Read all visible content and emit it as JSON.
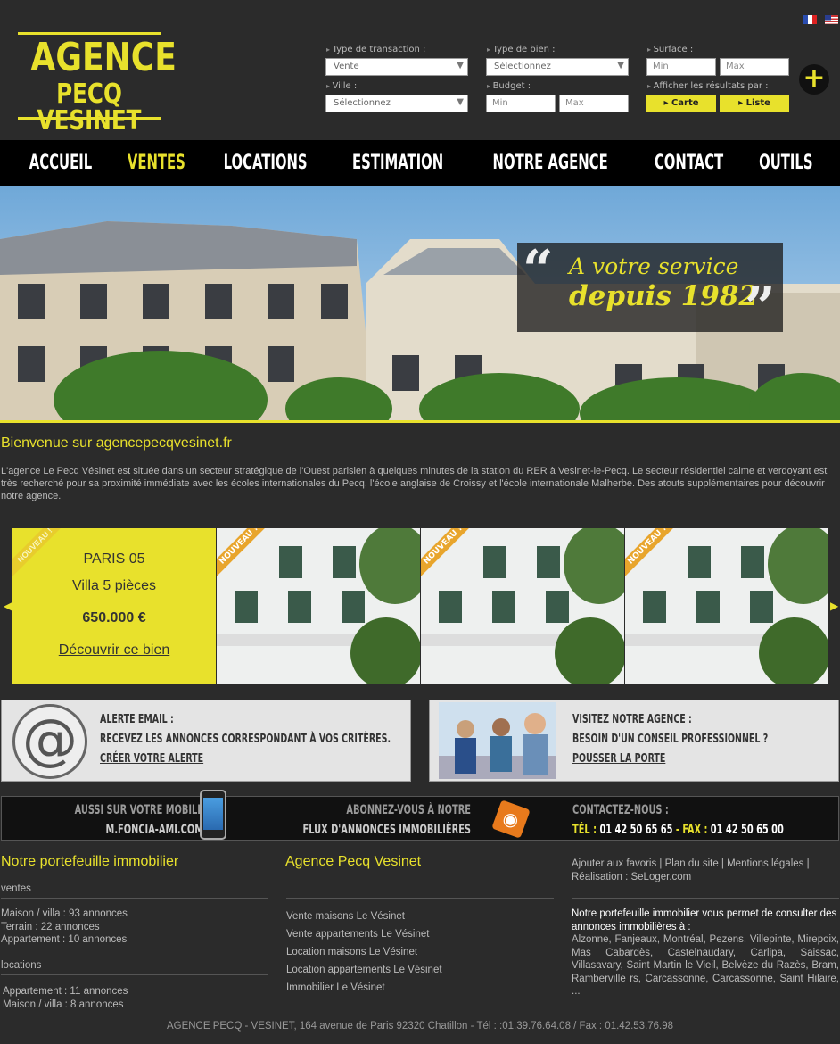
{
  "logo": {
    "line1": "AGENCE",
    "line2": "PECQ VESINET"
  },
  "search": {
    "transaction": {
      "label": "Type de transaction :",
      "value": "Vente"
    },
    "type_bien": {
      "label": "Type de bien :",
      "value": "Sélectionnez"
    },
    "surface": {
      "label": "Surface :",
      "min": "Min",
      "max": "Max"
    },
    "ville": {
      "label": "Ville :",
      "value": "Sélectionnez"
    },
    "budget": {
      "label": "Budget :",
      "min": "Min",
      "max": "Max"
    },
    "afficher": {
      "label": "Afficher les résultats par :",
      "carte": "Carte",
      "liste": "Liste"
    },
    "plus": "+"
  },
  "nav": [
    "ACCUEIL",
    "VENTES",
    "LOCATIONS",
    "ESTIMATION",
    "NOTRE AGENCE",
    "CONTACT",
    "OUTILS"
  ],
  "hero": {
    "quote_line1": "A votre service",
    "quote_line2": "depuis 1982"
  },
  "welcome": "Bienvenue sur agencepecqvesinet.fr",
  "intro": "L'agence Le Pecq Vésinet est située dans un secteur stratégique de l'Ouest parisien à quelques minutes de la station du RER à Vesinet-le-Pecq. Le secteur résidentiel calme et verdoyant est très recherché pour sa proximité immédiate avec les écoles internationales du Pecq, l'école anglaise de Croissy et l'école internationale Malherbe. Des atouts supplémentaires pour découvrir notre agence.",
  "carousel": {
    "ribbon": "NOUVEAU !",
    "feature": {
      "city": "PARIS 05",
      "type": "Villa 5 pièces",
      "price": "650.000 €",
      "link": "Découvrir ce bien"
    }
  },
  "promo_email": {
    "line1": "ALERTE EMAIL :",
    "line2": "RECEVEZ LES ANNONCES CORRESPONDANT À VOS CRITÈRES.",
    "link": "CRÉER VOTRE ALERTE"
  },
  "promo_agence": {
    "line1": "VISITEZ NOTRE AGENCE :",
    "line2": "BESOIN D'UN CONSEIL PROFESSIONNEL ?",
    "link": "POUSSER LA PORTE"
  },
  "band": {
    "mobile1": "AUSSI SUR VOTRE  MOBILE",
    "mobile2": "M.FONCIA-AMI.COM",
    "rss1": "ABONNEZ-VOUS À NOTRE",
    "rss2": "FLUX D'ANNONCES IMMOBILIÈRES",
    "contact1": "CONTACTEZ-NOUS :",
    "tel_label": "TÉL : ",
    "tel": "01 42 50 65 65",
    "fax_label": " - FAX : ",
    "fax": "01 42 50 65 00"
  },
  "footer": {
    "col1_title": "Notre portefeuille immobilier",
    "ventes_label": "ventes",
    "ventes": [
      "Maison / villa : 93 annonces",
      "Terrain : 22 annonces",
      "Appartement : 10 annonces"
    ],
    "locations_label": "locations",
    "locations": [
      "Appartement : 11 annonces",
      "Maison / villa : 8 annonces"
    ],
    "col2_title": "Agence Pecq Vesinet",
    "col2_links": [
      "Vente maisons Le Vésinet",
      "Vente appartements Le Vésinet",
      "Location maisons Le Vésinet",
      "Location appartements Le Vésinet",
      "Immobilier Le Vésinet"
    ],
    "col3_links": "Ajouter aux favoris | Plan du site | Mentions légales | Réalisation : SeLoger.com",
    "col3_title": "Notre portefeuille immobilier vous permet de consulter des annonces immobilières à :",
    "col3_towns": "Alzonne, Fanjeaux, Montréal, Pezens, Villepinte, Mirepoix, Mas Cabardès, Castelnaudary, Carlipa, Saissac, Villasavary, Saint Martin le Vieil, Belvèze du Razès, Bram, Ramberville rs, Carcassonne, Carcassonne, Saint Hilaire, ...",
    "address": "AGENCE PECQ - VESINET, 164 avenue de Paris 92320 Chatillon - Tél : :01.39.76.64.08 / Fax : 01.42.53.76.98"
  },
  "colors": {
    "accent": "#e8e12c",
    "bg": "#2b2b2b",
    "nav_bg": "#000000"
  }
}
